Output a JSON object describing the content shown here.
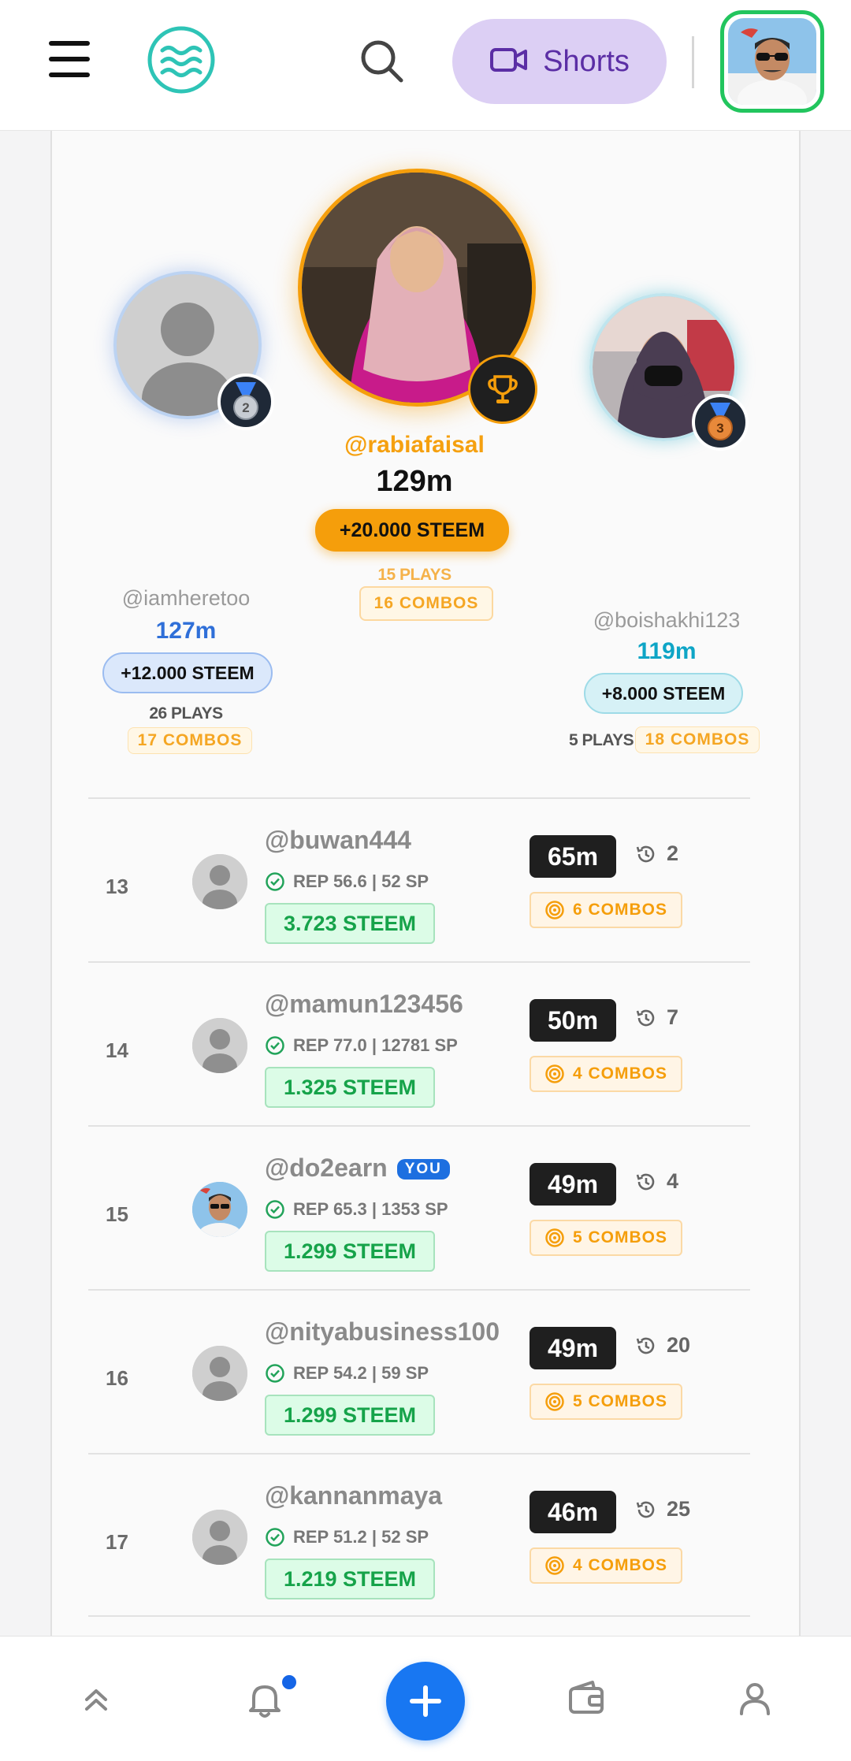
{
  "header": {
    "shorts_label": "Shorts"
  },
  "podium": {
    "first": {
      "username": "@rabiafaisal",
      "score": "129m",
      "reward": "+20.000 STEEM",
      "plays": "15 PLAYS",
      "combos": "16 COMBOS"
    },
    "second": {
      "username": "@iamheretoo",
      "score": "127m",
      "reward": "+12.000 STEEM",
      "plays": "26 PLAYS",
      "combos": "17 COMBOS",
      "badge_number": "2"
    },
    "third": {
      "username": "@boishakhi123",
      "score": "119m",
      "reward": "+8.000 STEEM",
      "plays": "5 PLAYS",
      "combos": "18 COMBOS",
      "badge_number": "3"
    }
  },
  "leaderboard": {
    "rows": [
      {
        "rank": "13",
        "username": "@buwan444",
        "rep": "REP 56.6 | 52 SP",
        "steem": "3.723 STEEM",
        "score": "65m",
        "plays": "2",
        "combos": "6 COMBOS"
      },
      {
        "rank": "14",
        "username": "@mamun123456",
        "rep": "REP 77.0 | 12781 SP",
        "steem": "1.325 STEEM",
        "score": "50m",
        "plays": "7",
        "combos": "4 COMBOS"
      },
      {
        "rank": "15",
        "username": "@do2earn",
        "you_badge": "YOU",
        "rep": "REP 65.3 | 1353 SP",
        "steem": "1.299 STEEM",
        "score": "49m",
        "plays": "4",
        "combos": "5 COMBOS"
      },
      {
        "rank": "16",
        "username": "@nityabusiness100",
        "rep": "REP 54.2 | 59 SP",
        "steem": "1.299 STEEM",
        "score": "49m",
        "plays": "20",
        "combos": "5 COMBOS"
      },
      {
        "rank": "17",
        "username": "@kannanmaya",
        "rep": "REP 51.2 | 52 SP",
        "steem": "1.219 STEEM",
        "score": "46m",
        "plays": "25",
        "combos": "4 COMBOS"
      }
    ]
  },
  "colors": {
    "accent_blue": "#1877f2",
    "gold": "#f59e0b",
    "green": "#16a34a",
    "shorts_bg": "#dccff4",
    "second_blue": "#2f6fd8",
    "third_cyan": "#0ea5c6"
  },
  "icons": {
    "menu": "hamburger-icon",
    "logo": "waves-logo-icon",
    "search": "search-icon",
    "shorts": "video-camera-icon",
    "trophy": "trophy-icon",
    "medal": "medal-icon",
    "verified": "check-circle-icon",
    "history": "history-icon",
    "target": "target-icon",
    "nav": [
      "double-chevron-up-icon",
      "bell-icon",
      "plus-icon",
      "wallet-icon",
      "user-icon"
    ]
  }
}
